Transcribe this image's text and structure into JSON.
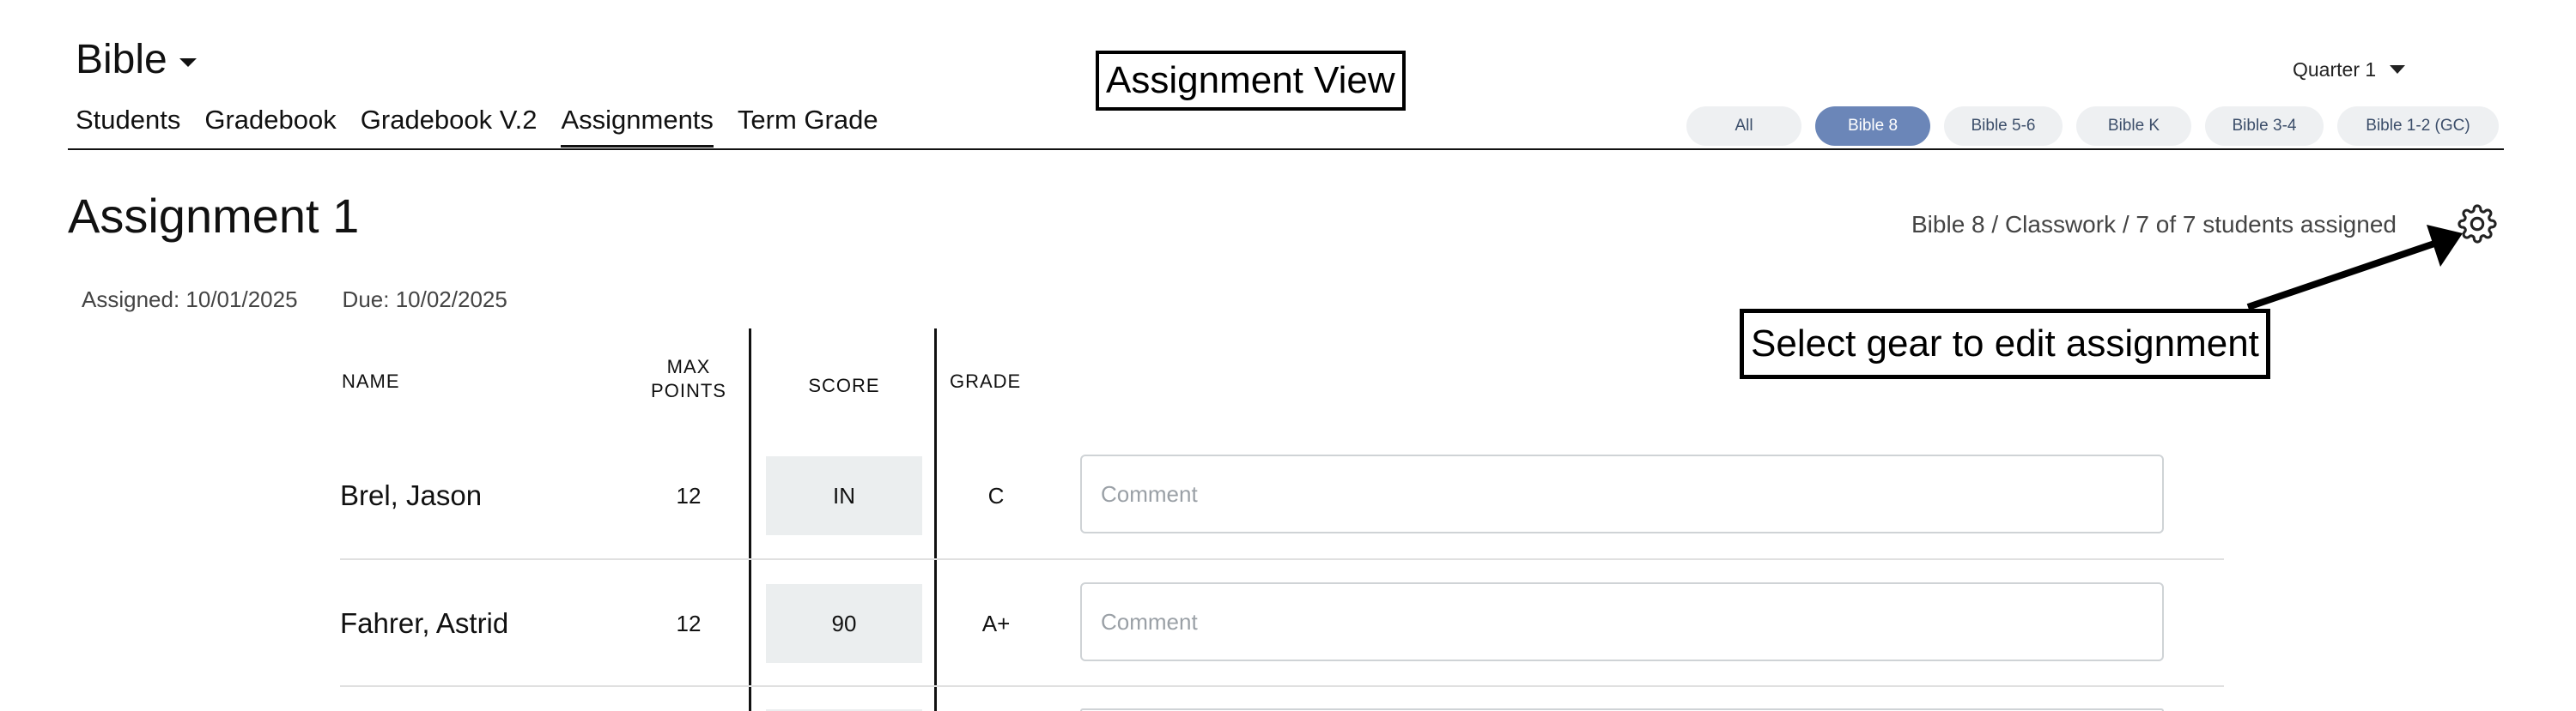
{
  "header": {
    "course_title": "Bible",
    "view_label": "Assignment View",
    "quarter": "Quarter 1"
  },
  "nav": {
    "tabs": [
      {
        "label": "Students"
      },
      {
        "label": "Gradebook"
      },
      {
        "label": "Gradebook V.2"
      },
      {
        "label": "Assignments",
        "active": true
      },
      {
        "label": "Term Grade"
      }
    ]
  },
  "class_filters": [
    {
      "label": "All"
    },
    {
      "label": "Bible 8",
      "active": true
    },
    {
      "label": "Bible 5-6"
    },
    {
      "label": "Bible K"
    },
    {
      "label": "Bible 3-4"
    },
    {
      "label": "Bible 1-2 (GC)"
    }
  ],
  "assignment": {
    "title": "Assignment 1",
    "path": "Bible 8 / Classwork / 7 of 7 students assigned",
    "assigned": "Assigned: 10/01/2025",
    "due": "Due: 10/02/2025"
  },
  "callout": {
    "text": "Select gear to edit assignment"
  },
  "table": {
    "headers": {
      "name": "NAME",
      "max_points_1": "MAX",
      "max_points_2": "POINTS",
      "score": "SCORE",
      "grade": "GRADE"
    },
    "comment_placeholder": "Comment",
    "rows": [
      {
        "name": "Brel, Jason",
        "max_points": "12",
        "score": "IN",
        "grade": "C"
      },
      {
        "name": "Fahrer, Astrid",
        "max_points": "12",
        "score": "90",
        "grade": "A+"
      }
    ]
  },
  "colors": {
    "active_pill": "#6b86b8",
    "pill_bg": "#eef0f2",
    "score_bg": "#ebeeef"
  },
  "icons": {
    "gear": "gear-icon",
    "course_dropdown": "chevron-down-icon",
    "quarter_dropdown": "chevron-down-icon"
  }
}
